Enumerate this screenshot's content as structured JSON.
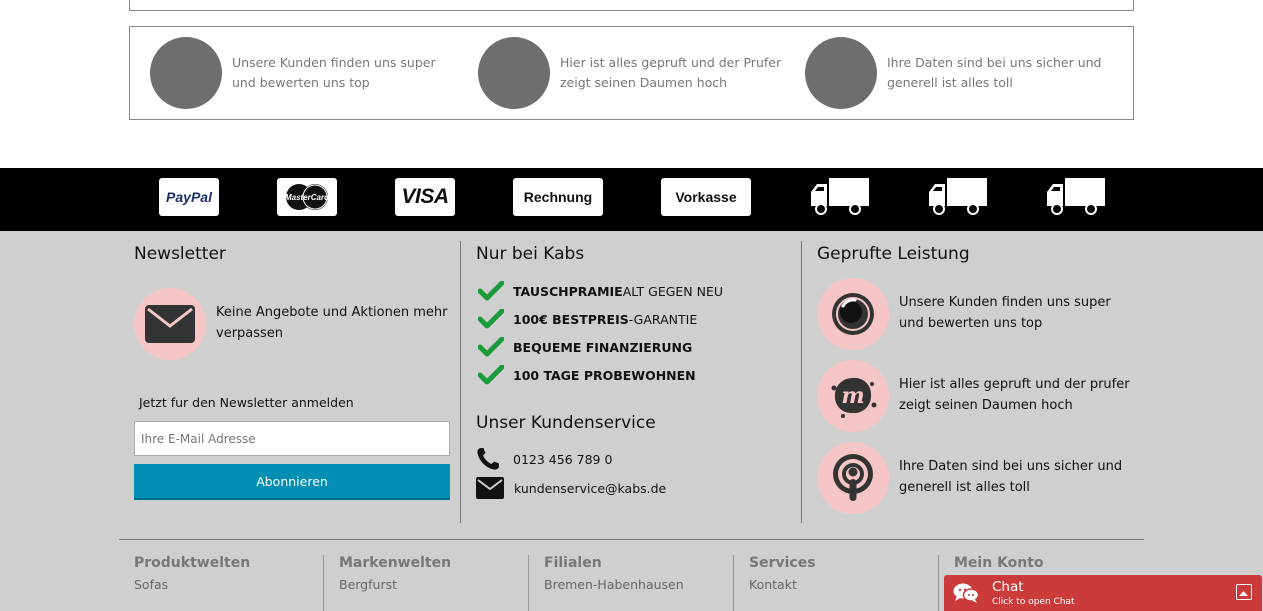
{
  "trust_box": {
    "items": [
      {
        "text": "Unsere Kunden finden uns super und bewerten uns top"
      },
      {
        "text": "Hier ist alles gepruft und der Prufer zeigt seinen Daumen hoch"
      },
      {
        "text": "Ihre Daten sind bei uns sicher und generell ist alles toll"
      }
    ]
  },
  "payment": {
    "paypal": "PayPal",
    "mastercard": "MasterCard",
    "visa": "VISA",
    "rechnung": "Rechnung",
    "vorkasse": "Vorkasse",
    "truck_icon": "truck-icon"
  },
  "newsletter": {
    "title": "Newsletter",
    "description": "Keine Angebote und Aktionen mehr verpassen",
    "signup_label": "Jetzt fur den Newsletter anmelden",
    "email_placeholder": "Ihre E-Mail Adresse",
    "button_label": "Abonnieren"
  },
  "nur_bei_kabs": {
    "title": "Nur bei Kabs",
    "perks": [
      {
        "bold": "TAUSCHPRAMIE",
        "rest": " ALT GEGEN NEU"
      },
      {
        "bold": "100€ BESTPREIS",
        "rest": "-GARANTIE"
      },
      {
        "bold": "BEQUEME FINANZIERUNG",
        "rest": ""
      },
      {
        "bold": "100 TAGE PROBEWOHNEN",
        "rest": ""
      }
    ],
    "check_color": "#1a9a3a"
  },
  "kundenservice": {
    "title": "Unser Kundenservice",
    "phone": "0123 456 789 0",
    "email": "kundenservice@kabs.de"
  },
  "geprufte_leistung": {
    "title": "Geprufte Leistung",
    "items": [
      {
        "text": "Unsere Kunden finden uns super und bewerten uns top",
        "icon": "camera-lens-icon"
      },
      {
        "text": "Hier ist alles gepruft und der prufer zeigt seinen Daumen hoch",
        "icon": "meetup-icon"
      },
      {
        "text": "Ihre Daten sind bei uns sicher und generell ist alles toll",
        "icon": "podcast-icon"
      }
    ]
  },
  "footer_links": [
    {
      "heading": "Produktwelten",
      "first": "Sofas"
    },
    {
      "heading": "Markenwelten",
      "first": "Bergfurst"
    },
    {
      "heading": "Filialen",
      "first": "Bremen-Habenhausen"
    },
    {
      "heading": "Services",
      "first": "Kontakt"
    },
    {
      "heading": "Mein Konto",
      "first": ""
    }
  ],
  "chat": {
    "title": "Chat",
    "subtitle": "Click to open Chat"
  },
  "colors": {
    "pink": "#f6c6c6",
    "footer_bg": "#cfcfcf",
    "button_blue": "#008fb3",
    "chat_red": "#cc3b3b"
  }
}
